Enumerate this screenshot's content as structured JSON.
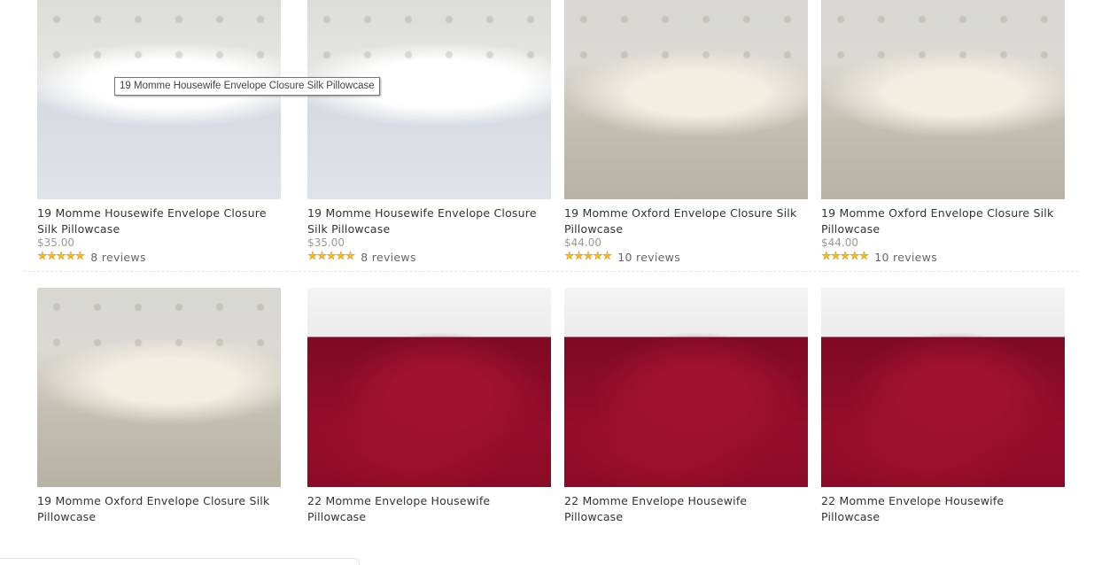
{
  "tooltip": "19 Momme Housewife Envelope Closure Silk Pillowcase",
  "products": [
    {
      "title": "19 Momme Housewife Envelope Closure Silk Pillowcase",
      "price": "$35.00",
      "stars": "★★★★★",
      "rating": 5,
      "reviews": "8 reviews",
      "image": "white-silk-pillowcase"
    },
    {
      "title": "19 Momme Housewife Envelope Closure Silk Pillowcase",
      "price": "$35.00",
      "stars": "★★★★★",
      "rating": 5,
      "reviews": "8 reviews",
      "image": "white-silk-pillowcase"
    },
    {
      "title": "19 Momme Oxford Envelope Closure Silk Pillowcase",
      "price": "$44.00",
      "stars": "★★★★★",
      "rating": 5,
      "reviews": "10 reviews",
      "image": "champagne-silk-pillowcase"
    },
    {
      "title": "19 Momme Oxford Envelope Closure Silk Pillowcase",
      "price": "$44.00",
      "stars": "★★★★★",
      "rating": 5,
      "reviews": "10 reviews",
      "image": "champagne-silk-pillowcase"
    },
    {
      "title": "19 Momme Oxford Envelope Closure Silk Pillowcase",
      "image": "champagne-silk-pillowcase"
    },
    {
      "title": "22 Momme Envelope Housewife Pillowcase",
      "image": "red-silk-pillowcase"
    },
    {
      "title": "22 Momme Envelope Housewife Pillowcase",
      "image": "red-silk-pillowcase"
    },
    {
      "title": "22 Momme Envelope Housewife Pillowcase",
      "image": "red-silk-pillowcase"
    }
  ]
}
